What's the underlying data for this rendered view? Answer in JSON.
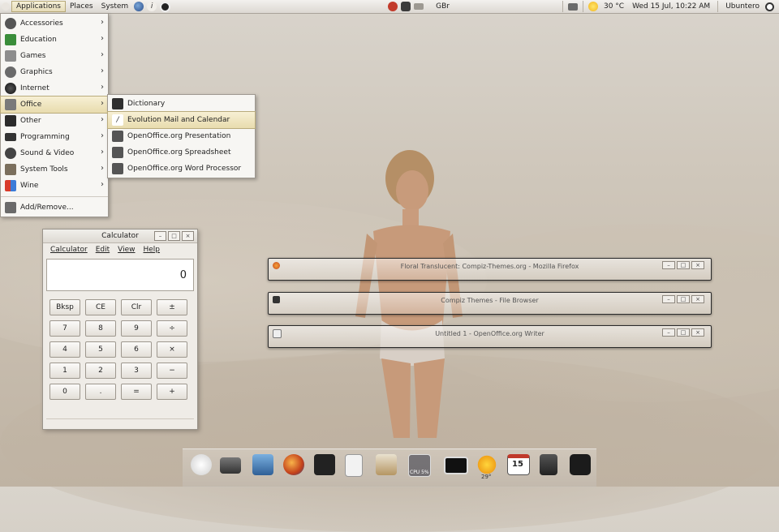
{
  "top_panel": {
    "menus": [
      "Applications",
      "Places",
      "System"
    ],
    "keyboard_layout": "GBr",
    "weather": "30 °C",
    "datetime": "Wed 15 Jul, 10:22 AM",
    "user": "Ubuntero"
  },
  "apps_menu": {
    "items": [
      {
        "label": "Accessories",
        "icon": "accessories-icon"
      },
      {
        "label": "Education",
        "icon": "education-icon"
      },
      {
        "label": "Games",
        "icon": "games-icon"
      },
      {
        "label": "Graphics",
        "icon": "graphics-icon"
      },
      {
        "label": "Internet",
        "icon": "internet-icon"
      },
      {
        "label": "Office",
        "icon": "office-icon"
      },
      {
        "label": "Other",
        "icon": "other-icon"
      },
      {
        "label": "Programming",
        "icon": "programming-icon"
      },
      {
        "label": "Sound & Video",
        "icon": "sound-video-icon"
      },
      {
        "label": "System Tools",
        "icon": "system-tools-icon"
      },
      {
        "label": "Wine",
        "icon": "wine-icon"
      }
    ],
    "add_remove": "Add/Remove..."
  },
  "office_submenu": {
    "items": [
      {
        "label": "Dictionary",
        "icon": "dictionary-icon"
      },
      {
        "label": "Evolution Mail and Calendar",
        "icon": "evolution-icon"
      },
      {
        "label": "OpenOffice.org Presentation",
        "icon": "presentation-icon"
      },
      {
        "label": "OpenOffice.org Spreadsheet",
        "icon": "spreadsheet-icon"
      },
      {
        "label": "OpenOffice.org Word Processor",
        "icon": "word-processor-icon"
      }
    ]
  },
  "calculator": {
    "title": "Calculator",
    "menus": [
      "Calculator",
      "Edit",
      "View",
      "Help"
    ],
    "display": "0",
    "keys": [
      "Bksp",
      "CE",
      "Clr",
      "±",
      "7",
      "8",
      "9",
      "÷",
      "4",
      "5",
      "6",
      "×",
      "1",
      "2",
      "3",
      "−",
      "0",
      ".",
      "=",
      "+"
    ]
  },
  "minimized_windows": [
    {
      "title": "Floral Translucent: Compiz-Themes.org - Mozilla Firefox",
      "icon": "firefox-icon"
    },
    {
      "title": "Compiz Themes - File Browser",
      "icon": "folder-icon"
    },
    {
      "title": "Untitled 1 - OpenOffice.org Writer",
      "icon": "document-icon"
    }
  ],
  "dock": {
    "cpu_label": "CPU 5%",
    "weather_label": "29°",
    "calendar_day": "15",
    "icons": [
      "apple-icon",
      "hard-drive-icon",
      "save-icon",
      "firefox-icon",
      "terminal-icon",
      "calculator-icon",
      "image-viewer-icon",
      "cpu-monitor-icon",
      "monitor-icon",
      "weather-icon",
      "calendar-icon",
      "trash-icon",
      "power-icon"
    ]
  }
}
